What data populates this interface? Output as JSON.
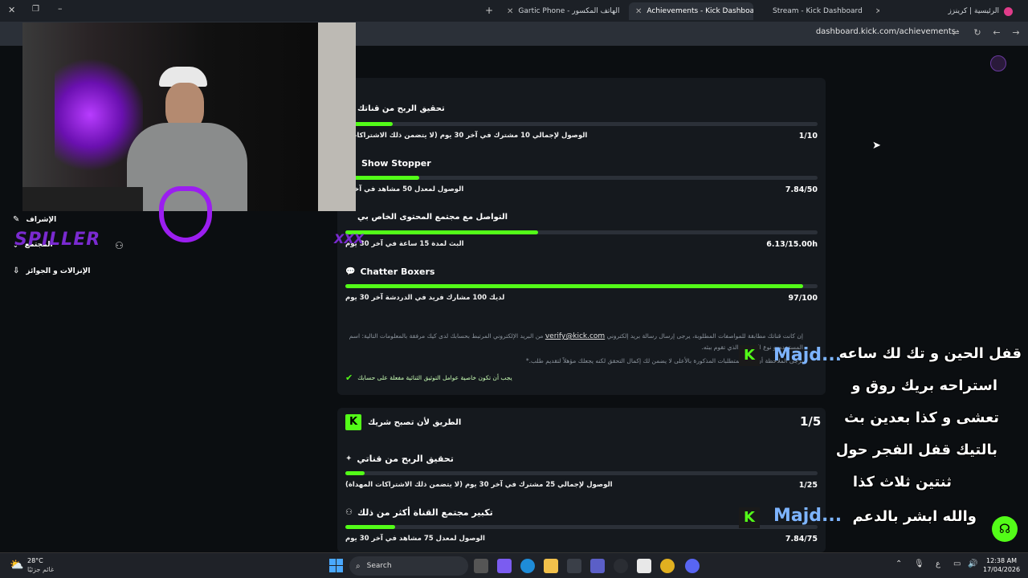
{
  "browser": {
    "tabs": [
      {
        "label": "الرئيسية | كرينزز",
        "active": false
      },
      {
        "label": "Stream - Kick Dashboard",
        "active": false
      },
      {
        "label": "Achievements - Kick Dashboard",
        "active": true
      },
      {
        "label": "Gartic Phone - الهاتف المكسور",
        "active": false
      }
    ],
    "url": "dashboard.kick.com/achievements",
    "new_tab": "+"
  },
  "sidebar": {
    "items": [
      {
        "label": "الإشراف"
      },
      {
        "label": "المجتمع"
      },
      {
        "label": "الإنزالات و الجوائز"
      }
    ]
  },
  "overlay": {
    "streamer_name": "SPILLER",
    "tag": "XXX"
  },
  "card1": {
    "achievements": [
      {
        "title": "تحقيق الربح من قناتك",
        "desc": "الوصول لإجمالي 10 مشترك في آخر 30 يوم (لا يتضمن ذلك الاشتراكات ا",
        "value": "1/10",
        "progress": 0.1
      },
      {
        "title": "Show Stopper",
        "desc": "الوصول لمعدل 50 مشاهد في آخر ا",
        "value": "7.84/50",
        "progress": 0.157
      },
      {
        "title": "التواصل مع مجتمع المحتوى الخاص بي",
        "desc": "البث لمدة 15 ساعة في آخر 30 يوم",
        "value": "6.13/15.00h",
        "progress": 0.409
      },
      {
        "title": "Chatter Boxers",
        "desc": "لديك 100 مشارك فريد في الدردشة آخر 30 يوم",
        "value": "97/100",
        "progress": 0.97
      }
    ],
    "note_part1": "إن كانت قناتك مطابقة للمواصفات المطلوبة، يرجى إرسال رسالة بريد إلكتروني",
    "note_email": "verify@kick.com",
    "note_part2": "من البريد الإلكتروني المرتبط بحسابك لدى كيك مرفقة بالمعلومات التالية: اسم المستخدم و نوع المحتوى الذي تقوم ببثه.",
    "note_line3": "يرجى الملاحظة أن تلبية المتطلبات المذكورة بالأعلى لا يضمن لك إكمال التحقق لكنه يجعلك مؤهلاً لتقديم طلب.*",
    "note_check": "يجب أن تكون خاصية عوامل التوثيق الثنائية مفعلة على حسابك"
  },
  "card2": {
    "title": "الطريق لأن تصبح شريك",
    "count": "1/5",
    "achievements": [
      {
        "title": "تحقيق الربح من قناتي",
        "desc": "الوصول لإجمالي 25 مشترك في آخر 30 يوم (لا يتضمن ذلك الاشتراكات المهداة)",
        "value": "1/25",
        "progress": 0.04
      },
      {
        "title": "تكبير مجتمع القناة أكثر من ذلك",
        "desc": "الوصول لمعدل 75 مشاهد في آخر 30 يوم",
        "value": "7.84/75",
        "progress": 0.105
      }
    ]
  },
  "chat": {
    "username": "Majd...",
    "message1_lines": [
      "قفل الحين و تك لك ساعه",
      "استراحه بريك روق و",
      "تعشى و كذا بعدين بث",
      "بالتيك قفل الفجر حول",
      "ثنتين ثلاث كذا"
    ],
    "message2": "والله ابشر بالدعم"
  },
  "taskbar": {
    "weather_temp": "28°C",
    "weather_desc": "غائم جزئيًا",
    "search_label": "Search",
    "time": "12:38 AM",
    "date": "17/04/2026",
    "lang": "ع"
  },
  "colors": {
    "accent": "#53fc18",
    "bg": "#0b0e11",
    "card": "#15191e"
  }
}
